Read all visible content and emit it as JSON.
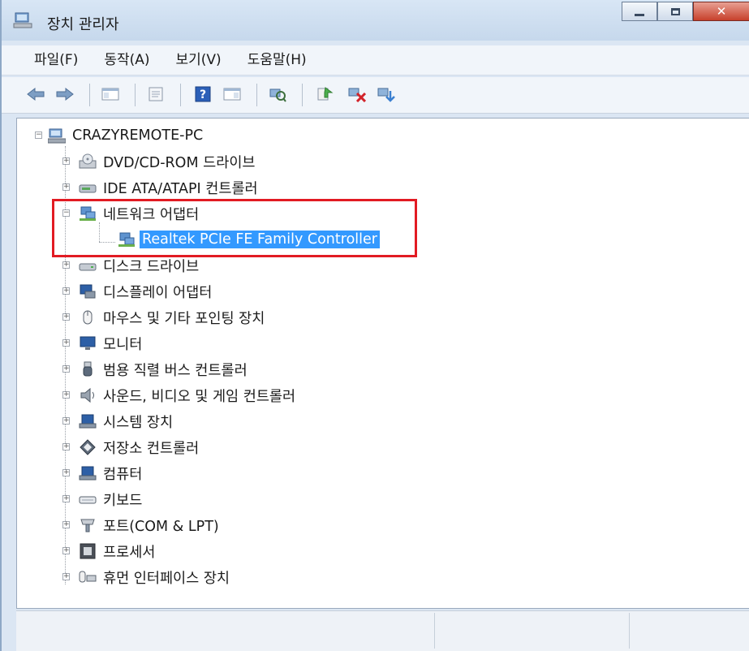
{
  "window": {
    "title": "장치 관리자"
  },
  "menu": [
    "파일(F)",
    "동작(A)",
    "보기(V)",
    "도움말(H)"
  ],
  "toolbar": {
    "buttons": [
      "back",
      "forward",
      "show-hide-console-tree",
      "properties",
      "help",
      "action-pane",
      "scan-hardware-changes",
      "update-driver",
      "disable-device",
      "uninstall-device"
    ]
  },
  "tree": {
    "root": "CRAZYREMOTE-PC",
    "categories": [
      {
        "label": "DVD/CD-ROM 드라이브",
        "icon": "dvd-drive-icon",
        "expanded": false
      },
      {
        "label": "IDE ATA/ATAPI 컨트롤러",
        "icon": "ide-controller-icon",
        "expanded": false
      },
      {
        "label": "네트워크 어댑터",
        "icon": "network-adapter-icon",
        "expanded": true,
        "children": [
          {
            "label": "Realtek PCIe FE Family Controller",
            "selected": true
          }
        ]
      },
      {
        "label": "디스크 드라이브",
        "icon": "disk-drive-icon",
        "expanded": false
      },
      {
        "label": "디스플레이 어댑터",
        "icon": "display-adapter-icon",
        "expanded": false
      },
      {
        "label": "마우스 및 기타 포인팅 장치",
        "icon": "mouse-icon",
        "expanded": false
      },
      {
        "label": "모니터",
        "icon": "monitor-icon",
        "expanded": false
      },
      {
        "label": "범용 직렬 버스 컨트롤러",
        "icon": "usb-icon",
        "expanded": false
      },
      {
        "label": "사운드, 비디오 및 게임 컨트롤러",
        "icon": "speaker-icon",
        "expanded": false
      },
      {
        "label": "시스템 장치",
        "icon": "system-device-icon",
        "expanded": false
      },
      {
        "label": "저장소 컨트롤러",
        "icon": "storage-controller-icon",
        "expanded": false
      },
      {
        "label": "컴퓨터",
        "icon": "computer-icon",
        "expanded": false
      },
      {
        "label": "키보드",
        "icon": "keyboard-icon",
        "expanded": false
      },
      {
        "label": "포트(COM & LPT)",
        "icon": "port-icon",
        "expanded": false
      },
      {
        "label": "프로세서",
        "icon": "processor-icon",
        "expanded": false
      },
      {
        "label": "휴먼 인터페이스 장치",
        "icon": "hid-icon",
        "expanded": false
      }
    ]
  },
  "colors": {
    "selection": "#3399ff",
    "highlight_box": "#e21b23",
    "chrome": "#dbe6f3"
  }
}
